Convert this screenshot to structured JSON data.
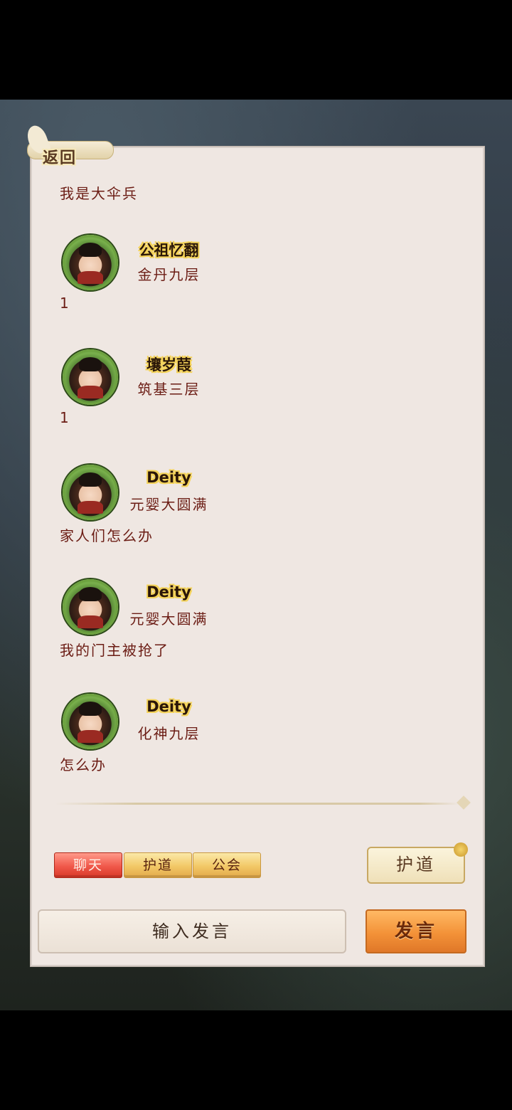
{
  "header": {
    "back_label": "返回"
  },
  "first_message": "我是大伞兵",
  "messages": [
    {
      "name": "公祖忆翻",
      "rank": "金丹九层",
      "text": "1"
    },
    {
      "name": "壤岁葭",
      "rank": "筑基三层",
      "text": "1"
    },
    {
      "name": "Deity",
      "rank": "元婴大圆满",
      "text": "家人们怎么办"
    },
    {
      "name": "Deity",
      "rank": "元婴大圆满",
      "text": "我的门主被抢了"
    },
    {
      "name": "Deity",
      "rank": "化神九层",
      "text": "怎么办"
    }
  ],
  "tabs": [
    {
      "label": "聊天",
      "active": true
    },
    {
      "label": "护道",
      "active": false
    },
    {
      "label": "公会",
      "active": false
    }
  ],
  "hudao_button": "护道",
  "input": {
    "placeholder": "输入发言"
  },
  "send_button": "发言",
  "colors": {
    "accent_red": "#e84a3a",
    "gold": "#f2c866",
    "text_red": "#6b1c14"
  }
}
